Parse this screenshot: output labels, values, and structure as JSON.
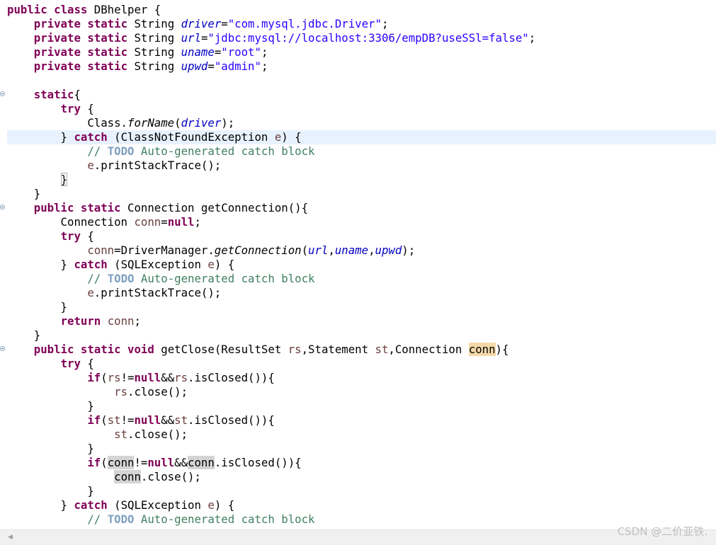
{
  "editor": {
    "lines": [
      [
        [
          "kw",
          "public "
        ],
        [
          "kw",
          "class "
        ],
        [
          "",
          "DBhelper {"
        ]
      ],
      [
        [
          "",
          "    "
        ],
        [
          "kw",
          "private "
        ],
        [
          "kw",
          "static "
        ],
        [
          "",
          "String "
        ],
        [
          "fld",
          "driver"
        ],
        [
          "",
          "="
        ],
        [
          "str",
          "\"com.mysql.jdbc.Driver\""
        ],
        [
          "",
          ";"
        ]
      ],
      [
        [
          "",
          "    "
        ],
        [
          "kw",
          "private "
        ],
        [
          "kw",
          "static "
        ],
        [
          "",
          "String "
        ],
        [
          "fld",
          "url"
        ],
        [
          "",
          "="
        ],
        [
          "str",
          "\"jdbc:mysql://localhost:3306/empDB?useSSl=false\""
        ],
        [
          "",
          ";"
        ]
      ],
      [
        [
          "",
          "    "
        ],
        [
          "kw",
          "private "
        ],
        [
          "kw",
          "static "
        ],
        [
          "",
          "String "
        ],
        [
          "fld",
          "uname"
        ],
        [
          "",
          "="
        ],
        [
          "str",
          "\"root\""
        ],
        [
          "",
          ";"
        ]
      ],
      [
        [
          "",
          "    "
        ],
        [
          "kw",
          "private "
        ],
        [
          "kw",
          "static "
        ],
        [
          "",
          "String "
        ],
        [
          "fld",
          "upwd"
        ],
        [
          "",
          "="
        ],
        [
          "str",
          "\"admin\""
        ],
        [
          "",
          ";"
        ]
      ],
      [],
      [
        [
          "",
          "    "
        ],
        [
          "kw",
          "static"
        ],
        [
          "",
          "{"
        ]
      ],
      [
        [
          "",
          "        "
        ],
        [
          "kw",
          "try"
        ],
        [
          "",
          " {"
        ]
      ],
      [
        [
          "",
          "            Class."
        ],
        [
          "mth",
          "forName"
        ],
        [
          "",
          "("
        ],
        [
          "fld",
          "driver"
        ],
        [
          "",
          ");"
        ]
      ],
      [
        [
          "",
          "        } "
        ],
        [
          "kw",
          "catch"
        ],
        [
          "",
          " (ClassNotFoundException "
        ],
        [
          "var",
          "e"
        ],
        [
          "",
          ") {"
        ]
      ],
      [
        [
          "",
          "            "
        ],
        [
          "cmt",
          "// "
        ],
        [
          "todo",
          "TODO"
        ],
        [
          "cmt",
          " Auto-generated catch block"
        ]
      ],
      [
        [
          "",
          "            "
        ],
        [
          "var",
          "e"
        ],
        [
          "",
          ".printStackTrace();"
        ]
      ],
      [
        [
          "",
          "        "
        ],
        [
          "brk",
          "}"
        ]
      ],
      [
        [
          "",
          "    }"
        ]
      ],
      [
        [
          "",
          "    "
        ],
        [
          "kw",
          "public "
        ],
        [
          "kw",
          "static "
        ],
        [
          "",
          "Connection getConnection(){"
        ]
      ],
      [
        [
          "",
          "        Connection "
        ],
        [
          "var",
          "conn"
        ],
        [
          "",
          "="
        ],
        [
          "kw",
          "null"
        ],
        [
          "",
          ";"
        ]
      ],
      [
        [
          "",
          "        "
        ],
        [
          "kw",
          "try"
        ],
        [
          "",
          " {"
        ]
      ],
      [
        [
          "",
          "            "
        ],
        [
          "var",
          "conn"
        ],
        [
          "",
          "=DriverManager."
        ],
        [
          "mth",
          "getConnection"
        ],
        [
          "",
          "("
        ],
        [
          "fld",
          "url"
        ],
        [
          "",
          ","
        ],
        [
          "fld",
          "uname"
        ],
        [
          "",
          ","
        ],
        [
          "fld",
          "upwd"
        ],
        [
          "",
          ");"
        ]
      ],
      [
        [
          "",
          "        } "
        ],
        [
          "kw",
          "catch"
        ],
        [
          "",
          " (SQLException "
        ],
        [
          "var",
          "e"
        ],
        [
          "",
          ") {"
        ]
      ],
      [
        [
          "",
          "            "
        ],
        [
          "cmt",
          "// "
        ],
        [
          "todo",
          "TODO"
        ],
        [
          "cmt",
          " Auto-generated catch block"
        ]
      ],
      [
        [
          "",
          "            "
        ],
        [
          "var",
          "e"
        ],
        [
          "",
          ".printStackTrace();"
        ]
      ],
      [
        [
          "",
          "        }"
        ]
      ],
      [
        [
          "",
          "        "
        ],
        [
          "kw",
          "return "
        ],
        [
          "var",
          "conn"
        ],
        [
          "",
          ";"
        ]
      ],
      [
        [
          "",
          "    }"
        ]
      ],
      [
        [
          "",
          "    "
        ],
        [
          "kw",
          "public "
        ],
        [
          "kw",
          "static "
        ],
        [
          "kw",
          "void "
        ],
        [
          "",
          "getClose(ResultSet "
        ],
        [
          "var",
          "rs"
        ],
        [
          "",
          ",Statement "
        ],
        [
          "var",
          "st"
        ],
        [
          "",
          ",Connection "
        ],
        [
          "occw",
          "conn"
        ],
        [
          "",
          "){"
        ]
      ],
      [
        [
          "",
          "        "
        ],
        [
          "kw",
          "try"
        ],
        [
          "",
          " {"
        ]
      ],
      [
        [
          "",
          "            "
        ],
        [
          "kw",
          "if"
        ],
        [
          "",
          "("
        ],
        [
          "var",
          "rs"
        ],
        [
          "",
          "!="
        ],
        [
          "kw",
          "null"
        ],
        [
          "",
          "&&"
        ],
        [
          "var",
          "rs"
        ],
        [
          "",
          ".isClosed()){"
        ]
      ],
      [
        [
          "",
          "                "
        ],
        [
          "var",
          "rs"
        ],
        [
          "",
          ".close();"
        ]
      ],
      [
        [
          "",
          "            }"
        ]
      ],
      [
        [
          "",
          "            "
        ],
        [
          "kw",
          "if"
        ],
        [
          "",
          "("
        ],
        [
          "var",
          "st"
        ],
        [
          "",
          "!="
        ],
        [
          "kw",
          "null"
        ],
        [
          "",
          "&&"
        ],
        [
          "var",
          "st"
        ],
        [
          "",
          ".isClosed()){"
        ]
      ],
      [
        [
          "",
          "                "
        ],
        [
          "var",
          "st"
        ],
        [
          "",
          ".close();"
        ]
      ],
      [
        [
          "",
          "            }"
        ]
      ],
      [
        [
          "",
          "            "
        ],
        [
          "kw",
          "if"
        ],
        [
          "",
          "("
        ],
        [
          "occ",
          "conn"
        ],
        [
          "",
          "!="
        ],
        [
          "kw",
          "null"
        ],
        [
          "",
          "&&"
        ],
        [
          "occ",
          "conn"
        ],
        [
          "",
          ".isClosed()){"
        ]
      ],
      [
        [
          "",
          "                "
        ],
        [
          "occ",
          "conn"
        ],
        [
          "",
          ".close();"
        ]
      ],
      [
        [
          "",
          "            }"
        ]
      ],
      [
        [
          "",
          "        } "
        ],
        [
          "kw",
          "catch"
        ],
        [
          "",
          " (SQLException "
        ],
        [
          "var",
          "e"
        ],
        [
          "",
          ") {"
        ]
      ],
      [
        [
          "",
          "            "
        ],
        [
          "cmt",
          "// "
        ],
        [
          "todo",
          "TODO"
        ],
        [
          "cmt",
          " Auto-generated catch block"
        ]
      ]
    ],
    "current_line": 9,
    "fold_lines": [
      6,
      14,
      24
    ]
  },
  "watermark": "CSDN @二价亚铁.",
  "icons": {
    "scroll_left": "triangle-left-icon"
  }
}
